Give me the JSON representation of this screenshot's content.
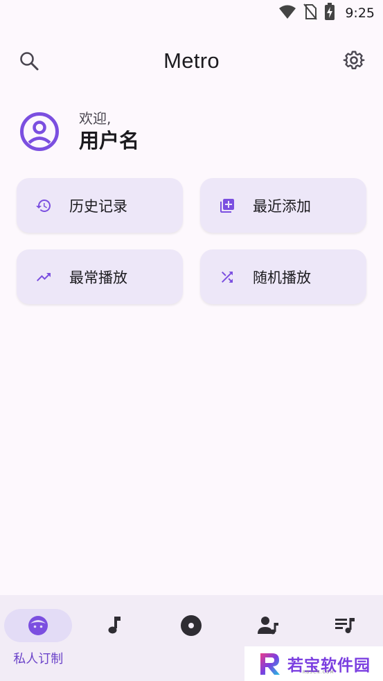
{
  "status_bar": {
    "time": "9:25"
  },
  "header": {
    "title": "Metro"
  },
  "welcome": {
    "greeting": "欢迎,",
    "username": "用户名"
  },
  "quick_actions": [
    {
      "label": "历史记录",
      "icon": "history-icon"
    },
    {
      "label": "最近添加",
      "icon": "library-add-icon"
    },
    {
      "label": "最常播放",
      "icon": "trending-up-icon"
    },
    {
      "label": "随机播放",
      "icon": "shuffle-icon"
    }
  ],
  "bottom_nav": {
    "items": [
      {
        "label": "私人订制",
        "icon": "face-icon",
        "active": true
      },
      {
        "label": "",
        "icon": "music-note-icon"
      },
      {
        "label": "",
        "icon": "album-icon"
      },
      {
        "label": "",
        "icon": "artist-icon"
      },
      {
        "label": "",
        "icon": "playlist-icon"
      }
    ]
  },
  "watermark": {
    "text": "若宝软件园",
    "sub": "RBSCN.COM"
  },
  "colors": {
    "accent": "#7b4fe0",
    "card_bg": "#ede7f8",
    "nav_bg": "#f2ecf6",
    "background": "#fdf8fd"
  }
}
